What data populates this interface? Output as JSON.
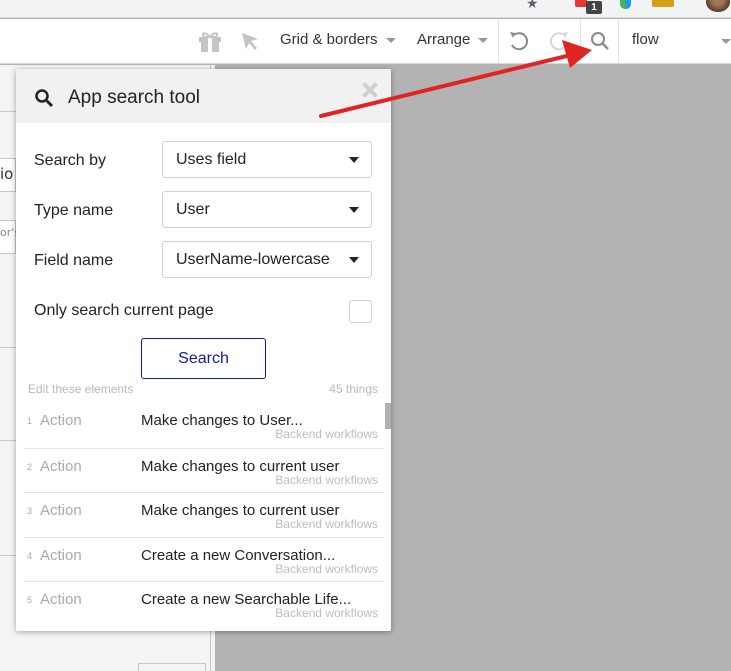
{
  "toolbar": {
    "gift_icon": "gift-icon",
    "pointer_icon": "pointer-icon",
    "grid_borders_label": "Grid & borders",
    "arrange_label": "Arrange",
    "undo_icon": "undo-icon",
    "redo_icon": "redo-icon",
    "search_icon": "search-icon",
    "page_selector_value": "flow"
  },
  "browser": {
    "extension_badge": "1"
  },
  "editor": {
    "partial_text_1": "io",
    "partial_text_2": "or's"
  },
  "panel": {
    "title": "App search tool",
    "search_by": {
      "label": "Search by",
      "value": "Uses field"
    },
    "type_name": {
      "label": "Type name",
      "value": "User"
    },
    "field_name": {
      "label": "Field name",
      "value": "UserName-lowercase"
    },
    "only_current_page": {
      "label": "Only search current page",
      "checked": false
    },
    "search_button": "Search",
    "results_caption": "Edit these elements",
    "results_count": "45 things",
    "results": [
      {
        "num": "1",
        "kind": "Action",
        "description": "Make changes to User...",
        "source": "Backend workflows"
      },
      {
        "num": "2",
        "kind": "Action",
        "description": "Make changes to current user",
        "source": "Backend workflows"
      },
      {
        "num": "3",
        "kind": "Action",
        "description": "Make changes to current user",
        "source": "Backend workflows"
      },
      {
        "num": "4",
        "kind": "Action",
        "description": "Create a new Conversation...",
        "source": "Backend workflows"
      },
      {
        "num": "5",
        "kind": "Action",
        "description": "Create a new Searchable Life...",
        "source": "Backend workflows"
      }
    ]
  },
  "colors": {
    "accent": "#0c1aa8",
    "annotation_arrow": "#e02424",
    "canvas_bg": "#b3b3b3"
  }
}
